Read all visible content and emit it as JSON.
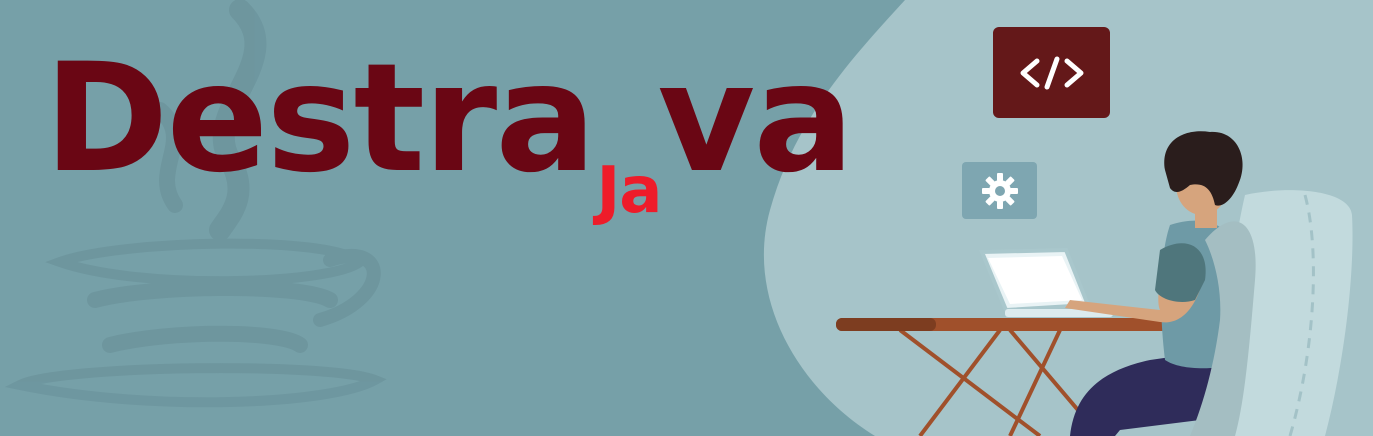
{
  "banner": {
    "logo": {
      "part1": "Destra",
      "part_small": "Ja",
      "part2": "va"
    },
    "icons": {
      "code": "code-brackets-icon",
      "gear": "gear-icon",
      "java": "java-cup-watermark-icon"
    },
    "colors": {
      "background": "#76a0a8",
      "blob": "#a6c4c9",
      "logo_dark": "#6a0614",
      "logo_accent": "#ee1c2a",
      "code_box": "#641819",
      "gear_box": "#7ea6b1",
      "desk": "#a0502b"
    }
  }
}
